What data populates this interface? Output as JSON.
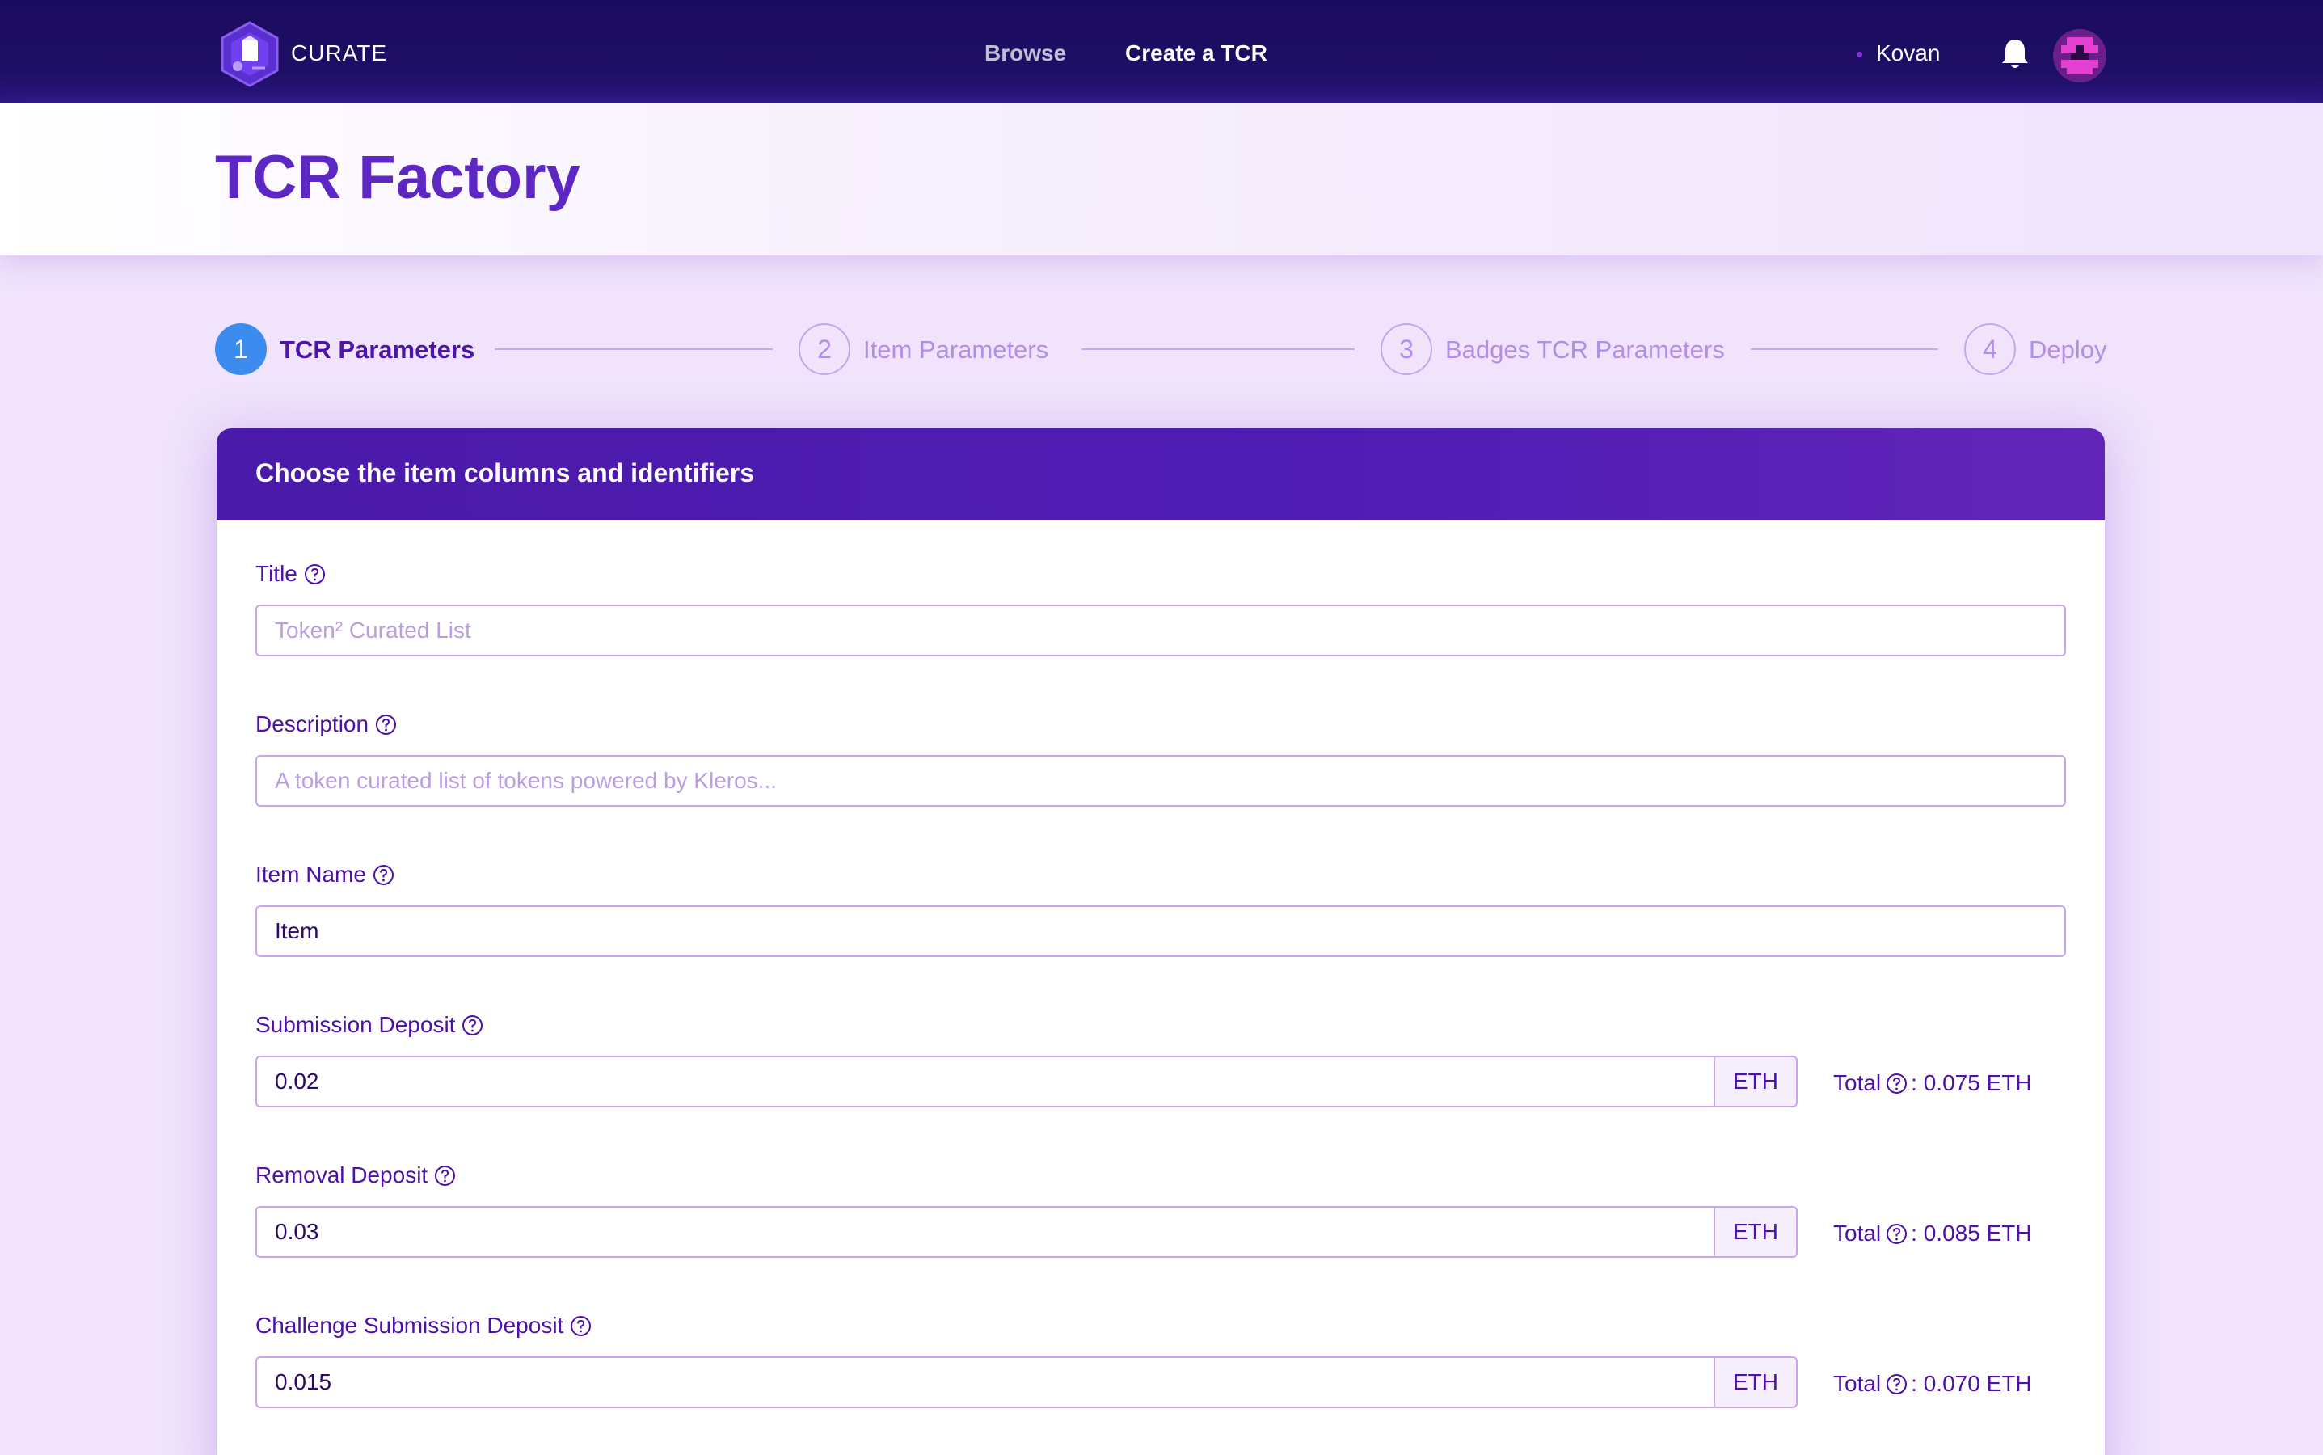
{
  "nav": {
    "logo_text": "CURATE",
    "browse": "Browse",
    "create": "Create a TCR",
    "network": "Kovan"
  },
  "page": {
    "title": "TCR Factory"
  },
  "stepper": [
    {
      "number": "1",
      "label": "TCR Parameters",
      "active": true
    },
    {
      "number": "2",
      "label": "Item Parameters",
      "active": false
    },
    {
      "number": "3",
      "label": "Badges TCR Parameters",
      "active": false
    },
    {
      "number": "4",
      "label": "Deploy",
      "active": false
    }
  ],
  "card": {
    "title": "Choose the item columns and identifiers",
    "fields": {
      "title": {
        "label": "Title",
        "value": "",
        "placeholder": "Token² Curated List"
      },
      "description": {
        "label": "Description",
        "value": "",
        "placeholder": "A token curated list of tokens powered by Kleros..."
      },
      "item_name": {
        "label": "Item Name",
        "value": "Item",
        "placeholder": ""
      },
      "submission_deposit": {
        "label": "Submission Deposit",
        "value": "0.02",
        "unit": "ETH",
        "total_label": "Total",
        "total_value": ": 0.075 ETH"
      },
      "removal_deposit": {
        "label": "Removal Deposit",
        "value": "0.03",
        "unit": "ETH",
        "total_label": "Total",
        "total_value": ": 0.085 ETH"
      },
      "challenge_submission_deposit": {
        "label": "Challenge Submission Deposit",
        "value": "0.015",
        "unit": "ETH",
        "total_label": "Total",
        "total_value": ": 0.070 ETH"
      }
    }
  },
  "colors": {
    "navbar": "#1a0b5e",
    "accent": "#5c27c2",
    "active_step": "#3c8cf0",
    "background": "#f0e3fb"
  },
  "icons": [
    "curate-logo-icon",
    "bell-icon",
    "help-circle-icon",
    "identicon-avatar"
  ]
}
